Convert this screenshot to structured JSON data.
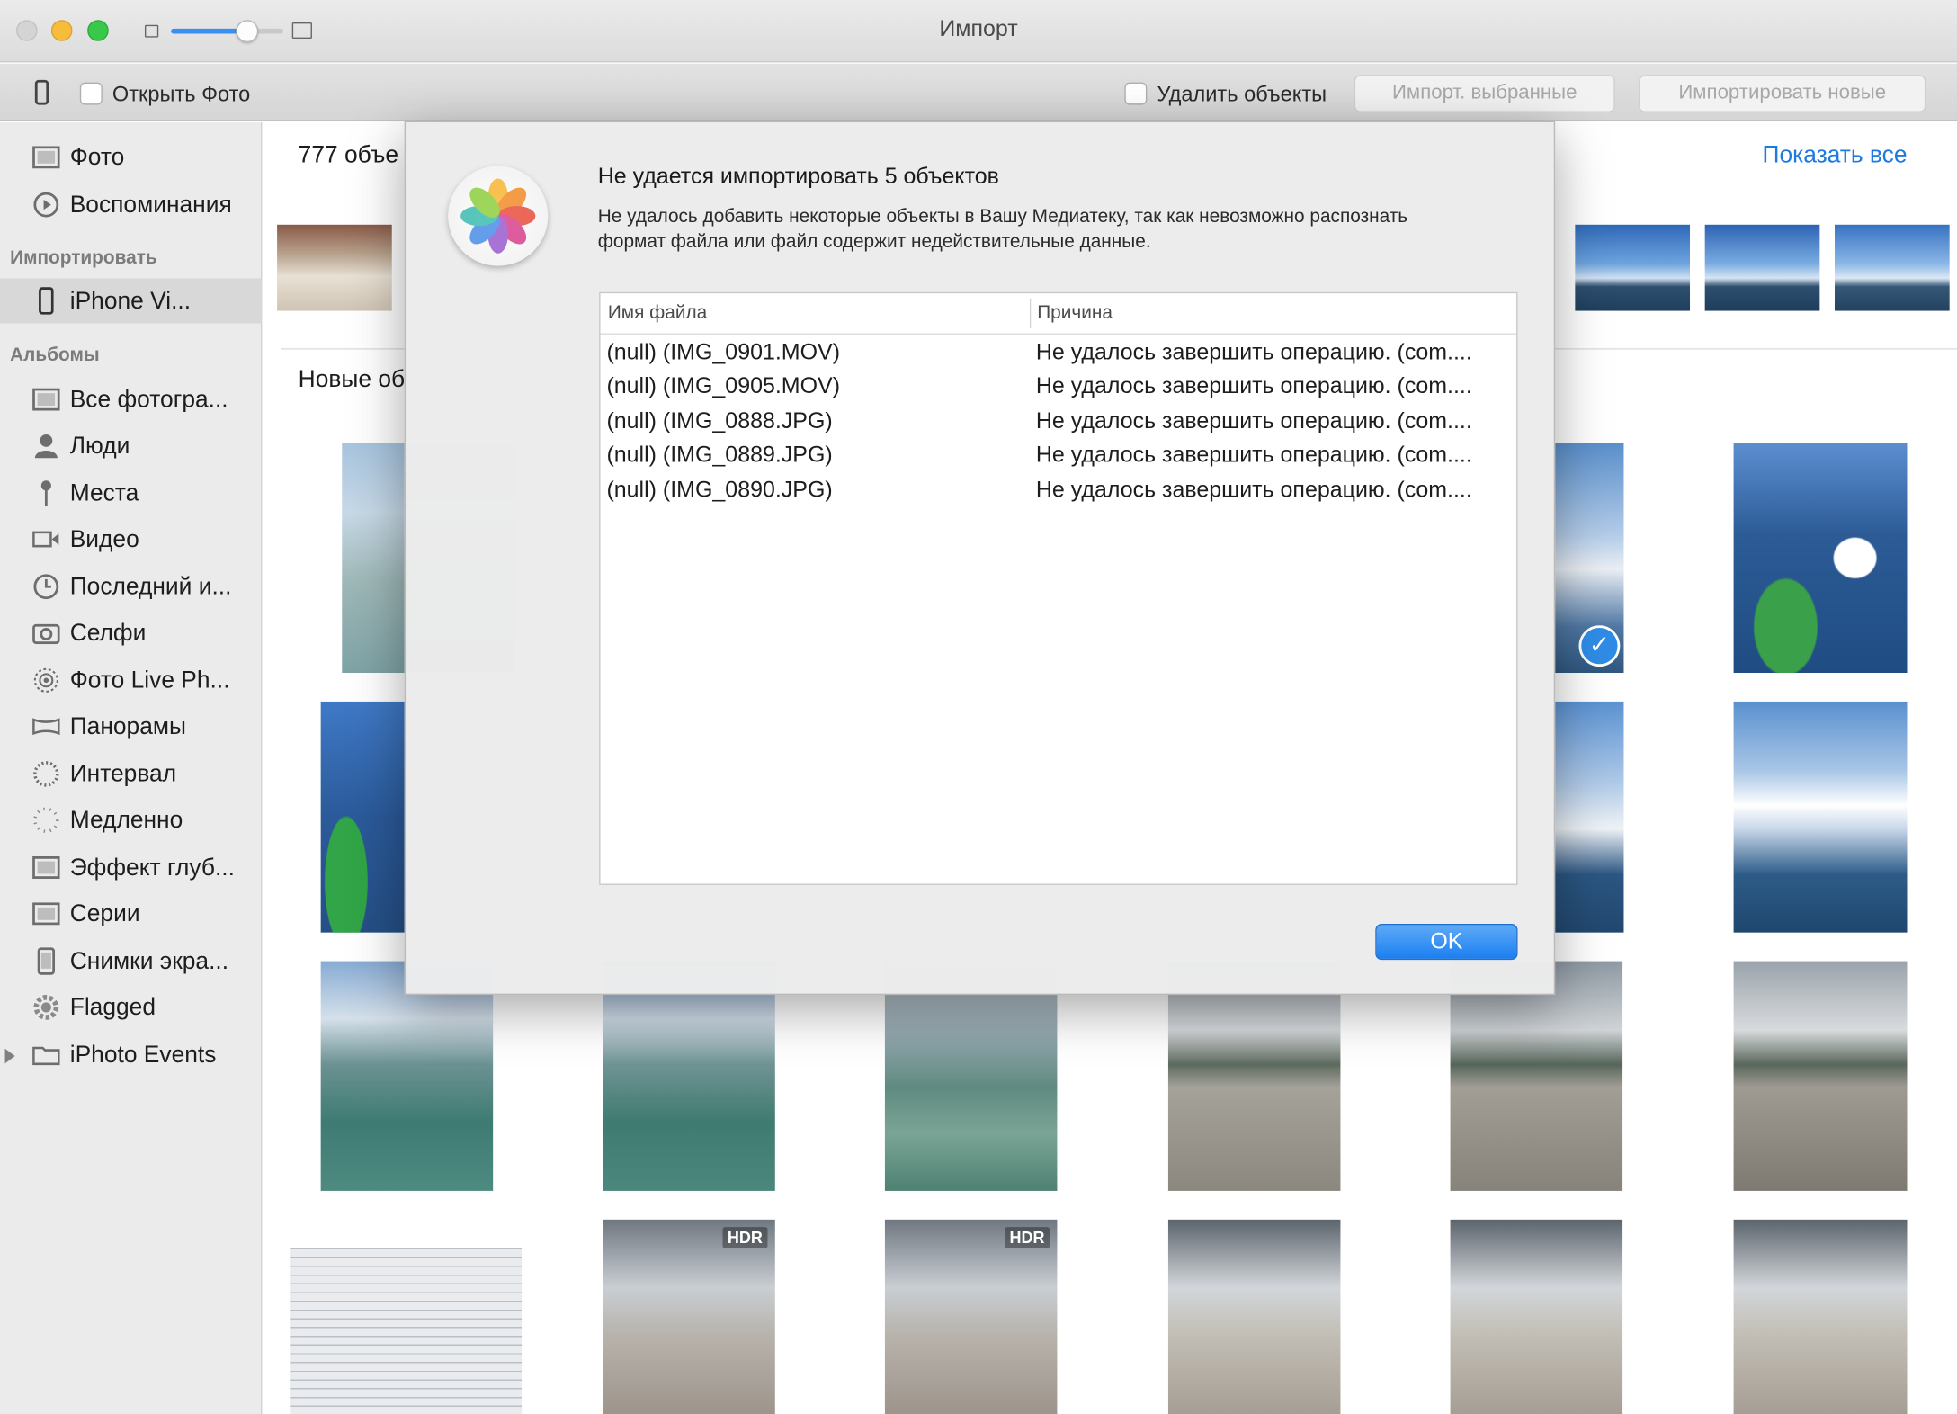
{
  "window": {
    "title": "Импорт"
  },
  "toolbar": {
    "open_photos_label": "Открыть Фото",
    "delete_items_label": "Удалить объекты",
    "import_selected_label": "Импорт. выбранные",
    "import_new_label": "Импортировать новые"
  },
  "sidebar": {
    "top_items": [
      {
        "label": "Фото",
        "icon": "photos-icon"
      },
      {
        "label": "Воспоминания",
        "icon": "memories-icon"
      }
    ],
    "import_header": "Импортировать",
    "device_label": "iPhone Vi...",
    "albums_header": "Альбомы",
    "albums": [
      {
        "label": "Все фотогра...",
        "icon": "all-photos-icon"
      },
      {
        "label": "Люди",
        "icon": "people-icon"
      },
      {
        "label": "Места",
        "icon": "places-pin-icon"
      },
      {
        "label": "Видео",
        "icon": "video-icon"
      },
      {
        "label": "Последний и...",
        "icon": "clock-icon"
      },
      {
        "label": "Селфи",
        "icon": "selfie-camera-icon"
      },
      {
        "label": "Фото Live Ph...",
        "icon": "live-photo-icon"
      },
      {
        "label": "Панорамы",
        "icon": "panorama-icon"
      },
      {
        "label": "Интервал",
        "icon": "timelapse-icon"
      },
      {
        "label": "Медленно",
        "icon": "slo-mo-icon"
      },
      {
        "label": "Эффект глуб...",
        "icon": "depth-effect-icon"
      },
      {
        "label": "Серии",
        "icon": "bursts-icon"
      },
      {
        "label": "Снимки экра...",
        "icon": "screenshot-icon"
      },
      {
        "label": "Flagged",
        "icon": "gear-icon"
      },
      {
        "label": "iPhoto Events",
        "icon": "folder-icon"
      }
    ]
  },
  "main": {
    "count_text": "777 объе",
    "show_all_label": "Показать все",
    "new_items_title": "Новые об",
    "hdr_badge": "HDR"
  },
  "dialog": {
    "title": "Не удается импортировать 5 объектов",
    "message": "Не удалось добавить некоторые объекты в Вашу Медиатеку, так как невозможно распознать формат файла или файл содержит недействительные данные.",
    "col_filename": "Имя файла",
    "col_reason": "Причина",
    "rows": [
      {
        "file": "(null) (IMG_0901.MOV)",
        "reason": "Не удалось завершить операцию. (com...."
      },
      {
        "file": "(null) (IMG_0905.MOV)",
        "reason": "Не удалось завершить операцию. (com...."
      },
      {
        "file": "(null) (IMG_0888.JPG)",
        "reason": "Не удалось завершить операцию. (com...."
      },
      {
        "file": "(null) (IMG_0889.JPG)",
        "reason": "Не удалось завершить операцию. (com...."
      },
      {
        "file": "(null) (IMG_0890.JPG)",
        "reason": "Не удалось завершить операцию. (com...."
      }
    ],
    "ok_label": "OK"
  },
  "colors": {
    "accent": "#1f7ae0",
    "sidebar_bg": "#ebebeb",
    "selected_row": "#d8d8d8",
    "ok_button": "#1c7ff0"
  }
}
